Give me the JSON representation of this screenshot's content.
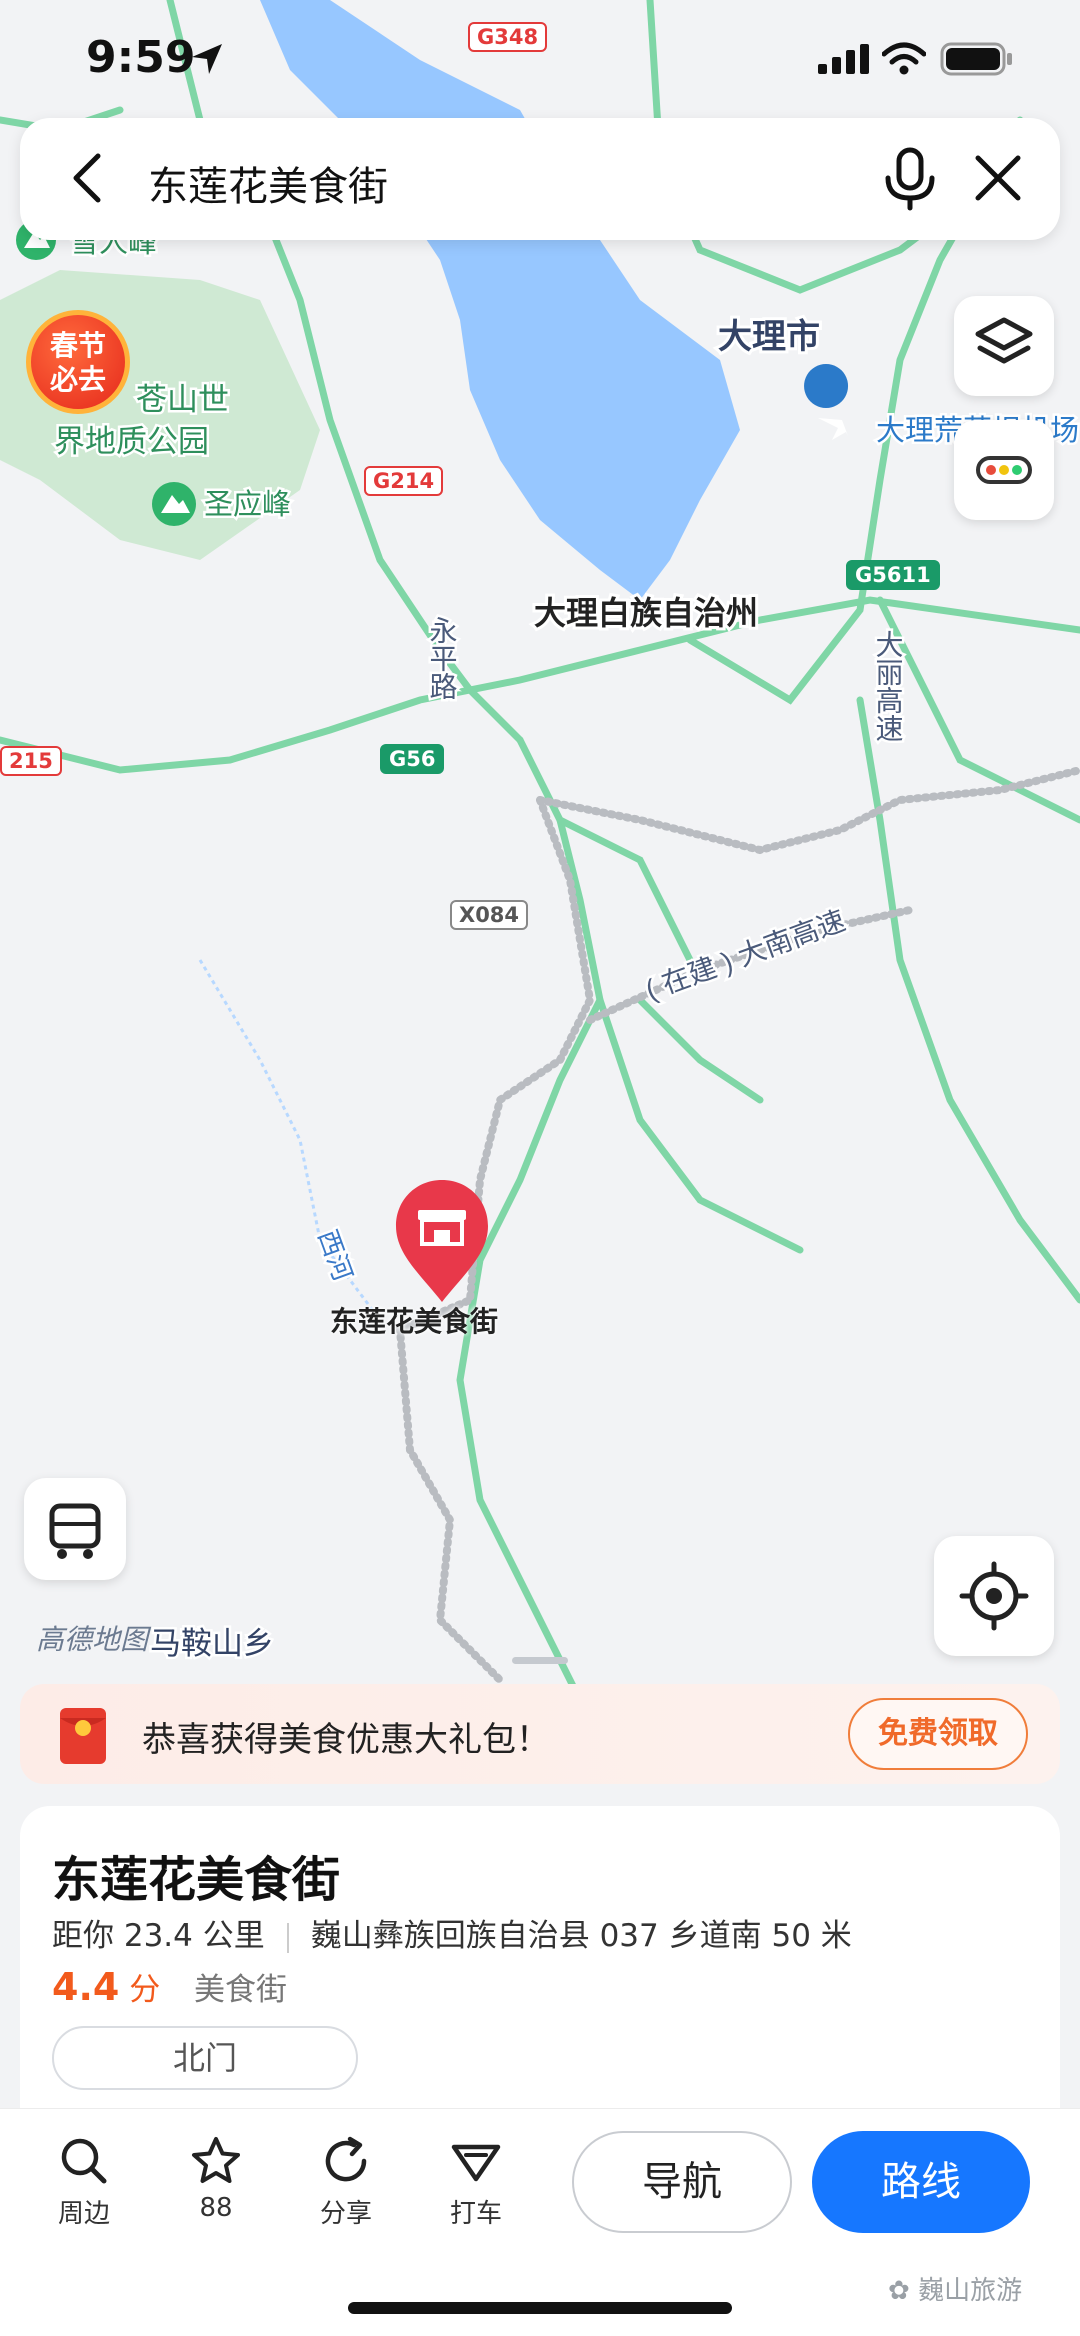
{
  "status_bar": {
    "time": "9:59"
  },
  "search": {
    "query": "东莲花美食街"
  },
  "map": {
    "labels": {
      "dali_city": "大理市",
      "dali_prefecture": "大理白族自治州",
      "airport": "大理荒草坝机场",
      "cangshan": "大理苍山世界地质公园",
      "cangshan_l1": "苍山世",
      "cangshan_l2": "界地质公园",
      "xuerenfeng": "雪人峰",
      "shengyingfeng": "圣应峰",
      "yongping_road": "永平路",
      "dali_expressway": "大丽高速",
      "danan_expressway": "( 在建 ) 大南高速",
      "xihe": "西河",
      "anshan": "马鞍山乡",
      "poi_pin": "东莲花美食街",
      "amap_watermark": "高德地图"
    },
    "shields": {
      "g348": "G348",
      "g214": "G214",
      "g5611": "G5611",
      "g56": "G56",
      "x084": "X084",
      "g215": "215"
    },
    "promo_badge": {
      "line1": "春节",
      "line2": "必去"
    }
  },
  "promo_bar": {
    "text": "恭喜获得美食优惠大礼包！",
    "button": "免费领取"
  },
  "poi": {
    "title": "东莲花美食街",
    "distance": "距你 23.4 公里",
    "address": "巍山彝族回族自治县 037 乡道南 50 米",
    "rating": "4.4",
    "rating_unit": "分",
    "category": "美食街",
    "gate": "北门"
  },
  "toolbar": {
    "nearby": "周边",
    "favorites_count": "88",
    "share": "分享",
    "taxi": "打车",
    "navigate": "导航",
    "route": "路线"
  },
  "watermark": "巍山旅游",
  "colors": {
    "accent": "#1677ff",
    "rating": "#f25a1c",
    "pin": "#e8384a",
    "water": "#97c7ff",
    "road": "#7fd6a6"
  }
}
